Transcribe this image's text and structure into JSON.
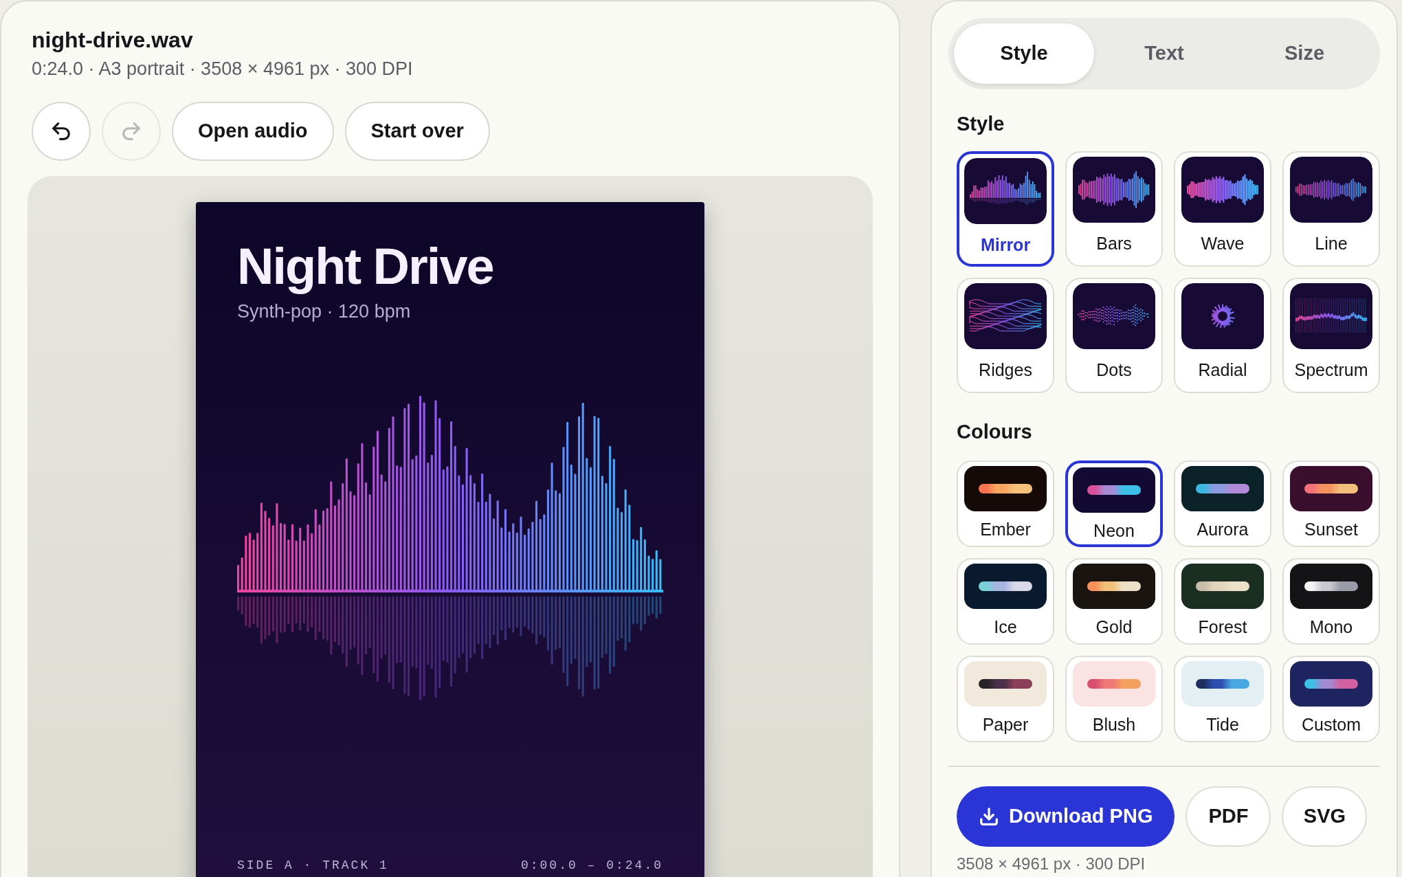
{
  "file": {
    "name": "night-drive.wav",
    "meta": "0:24.0 · A3 portrait · 3508 × 4961 px · 300 DPI"
  },
  "toolbar": {
    "undo": {
      "disabled": false
    },
    "redo": {
      "disabled": true
    },
    "buttons": [
      "Open audio",
      "Start over"
    ]
  },
  "poster": {
    "title": "Night Drive",
    "subtitle": "Synth-pop · 120 bpm",
    "footer_left": "SIDE A · TRACK 1",
    "footer_right": "0:00.0 – 0:24.0"
  },
  "tabs": [
    {
      "label": "Style",
      "selected": true
    },
    {
      "label": "Text",
      "selected": false
    },
    {
      "label": "Size",
      "selected": false
    }
  ],
  "style_section": {
    "heading": "Style",
    "options": [
      {
        "label": "Mirror",
        "kind": "mirror",
        "selected": true
      },
      {
        "label": "Bars",
        "kind": "bars",
        "selected": false
      },
      {
        "label": "Wave",
        "kind": "wave",
        "selected": false
      },
      {
        "label": "Line",
        "kind": "line",
        "selected": false
      },
      {
        "label": "Ridges",
        "kind": "ridges",
        "selected": false
      },
      {
        "label": "Dots",
        "kind": "dots",
        "selected": false
      },
      {
        "label": "Radial",
        "kind": "radial",
        "selected": false
      },
      {
        "label": "Spectrum",
        "kind": "spectrum",
        "selected": false
      }
    ]
  },
  "colour_section": {
    "heading": "Colours",
    "palettes": [
      {
        "label": "Ember",
        "color": "#150a08",
        "stops": [
          {
            "color": "#f97350"
          },
          {
            "color": "#f6a65f"
          },
          {
            "color": "#f5c07a"
          }
        ],
        "selected": false
      },
      {
        "label": "Neon",
        "color": "#120a33",
        "stops": [
          {
            "color": "#d9509a"
          },
          {
            "color": "#a78bd6"
          },
          {
            "color": "#3cc0e8"
          }
        ],
        "selected": true
      },
      {
        "label": "Aurora",
        "color": "#0a2228",
        "stops": [
          {
            "color": "#3cb8e0"
          },
          {
            "color": "#8a9be0"
          },
          {
            "color": "#b08ad6"
          }
        ],
        "selected": false
      },
      {
        "label": "Sunset",
        "color": "#3a0f2e",
        "stops": [
          {
            "color": "#f2707a"
          },
          {
            "color": "#f5935e"
          },
          {
            "color": "#f3c07c"
          }
        ],
        "selected": false
      },
      {
        "label": "Ice",
        "color": "#0a1a2e",
        "stops": [
          {
            "color": "#7ad0d8"
          },
          {
            "color": "#a8b4e0"
          },
          {
            "color": "#d8d8e8"
          }
        ],
        "selected": false
      },
      {
        "label": "Gold",
        "color": "#1a1410",
        "stops": [
          {
            "color": "#f59058"
          },
          {
            "color": "#f3c07a"
          },
          {
            "color": "#ece0c8"
          }
        ],
        "selected": false
      },
      {
        "label": "Forest",
        "color": "#1a2e22",
        "stops": [
          {
            "color": "#c6bca8"
          },
          {
            "color": "#e2d4bc"
          },
          {
            "color": "#ece0c8"
          }
        ],
        "selected": false
      },
      {
        "label": "Mono",
        "color": "#141416",
        "stops": [
          {
            "color": "#f4f4f4"
          },
          {
            "color": "#c8c8d0"
          },
          {
            "color": "#9a9aa8"
          }
        ],
        "selected": false
      },
      {
        "label": "Paper",
        "color": "#f1e9dc",
        "stops": [
          {
            "color": "#262326"
          },
          {
            "color": "#4a3048"
          },
          {
            "color": "#8a4058"
          }
        ],
        "selected": false
      },
      {
        "label": "Blush",
        "color": "#fbe3e3",
        "stops": [
          {
            "color": "#d9506e"
          },
          {
            "color": "#f07878"
          },
          {
            "color": "#f4a060"
          }
        ],
        "selected": false
      },
      {
        "label": "Tide",
        "color": "#e4eff4",
        "stops": [
          {
            "color": "#1d2f5e"
          },
          {
            "color": "#2e4fb0"
          },
          {
            "color": "#48a8e0"
          }
        ],
        "selected": false
      },
      {
        "label": "Custom",
        "color": "#1e2460",
        "stops": [
          {
            "color": "#3cc0e8"
          },
          {
            "color": "#a08ad0"
          },
          {
            "color": "#d060a0"
          }
        ],
        "selected": false
      }
    ]
  },
  "export": {
    "primary": "Download PNG",
    "others": [
      "PDF",
      "SVG"
    ],
    "caption": "3508 × 4961 px · 300 DPI"
  }
}
